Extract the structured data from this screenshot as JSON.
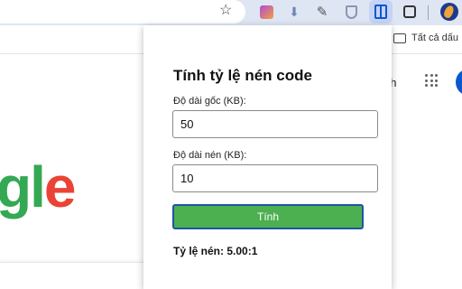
{
  "browser": {
    "icons": [
      "star-icon",
      "color-picker-icon",
      "download-icon",
      "note-icon",
      "shield-icon",
      "side-panel-icon",
      "puzzle-icon",
      "profile-icon"
    ],
    "bookmarks_bar": {
      "folder_label": "Tất cả dấu"
    }
  },
  "page": {
    "logo_text_1": "g",
    "logo_text_2": "l",
    "logo_text_3": "e",
    "link_text": "nh"
  },
  "popup": {
    "title": "Tính tỷ lệ nén code",
    "original_label": "Độ dài gốc (KB):",
    "original_value": "50",
    "compressed_label": "Độ dài nén (KB):",
    "compressed_value": "10",
    "button_label": "Tính",
    "result_text": "Tỷ lệ nén: 5.00:1"
  },
  "colors": {
    "button": "#4caf50",
    "button_border": "#1e56a0",
    "toolbar": "#dfe6f3",
    "accent": "#0b57d0"
  }
}
